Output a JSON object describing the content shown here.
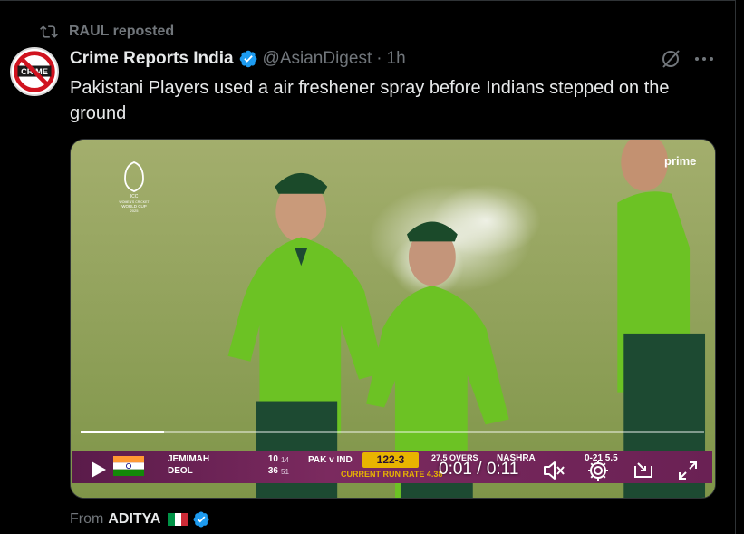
{
  "repost": {
    "label": "RAUL reposted"
  },
  "author": {
    "display_name": "Crime Reports India",
    "handle": "@AsianDigest",
    "separator": "·",
    "time": "1h",
    "avatar_text": "CRIME"
  },
  "tweet": {
    "text": "Pakistani Players used a air freshener spray before Indians stepped on the ground"
  },
  "video": {
    "broadcaster_logo": "prime",
    "event_logo_lines": [
      "ICC",
      "WOMEN'S CRICKET",
      "WORLD CUP",
      "2025"
    ],
    "progress_fraction": 0.133,
    "time_readout": "0:01 / 0:11",
    "scorebar": {
      "batter1_name": "JEMIMAH",
      "batter1_runs": "10",
      "batter1_balls": "14",
      "batter2_name": "DEOL",
      "batter2_runs": "36",
      "batter2_balls": "51",
      "match_label": "PAK v IND",
      "score": "122-3",
      "overs": "27.5 OVERS",
      "run_rate_label": "CURRENT RUN RATE 4.38",
      "bowler_name": "NASHRA",
      "bowler_figures": "0-21 5.5"
    },
    "controls": [
      "play-icon",
      "volume-muted-icon",
      "settings-gear-icon",
      "pip-icon",
      "fullscreen-icon"
    ]
  },
  "source": {
    "from_label": "From",
    "name": "ADITYA"
  },
  "colors": {
    "background": "#000000",
    "text_primary": "#e7e9ea",
    "text_secondary": "#71767b",
    "verified_blue": "#1d9bf0",
    "jersey_green": "#6ecb1f",
    "score_gold": "#e8b400"
  }
}
